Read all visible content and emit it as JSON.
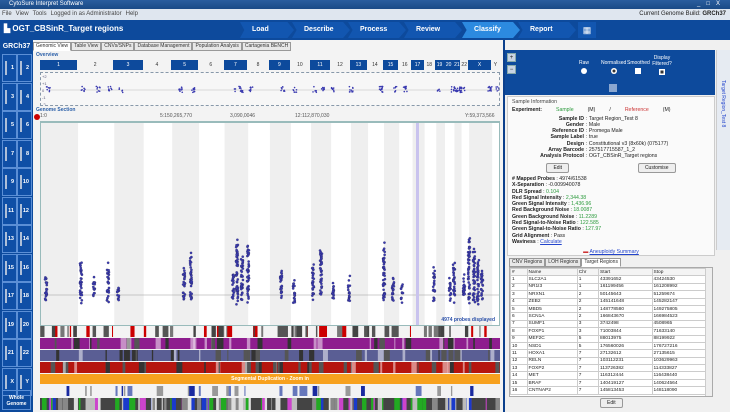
{
  "window": {
    "title": "CytoSure Interpret Software",
    "controls": [
      "_",
      "□",
      "X"
    ]
  },
  "menu": [
    "File",
    "View",
    "Tools",
    "Logged in as Administrator",
    "Help"
  ],
  "genome_build": {
    "label": "Current Genome Build:",
    "value": "GRCh37"
  },
  "document_title": "OGT_CBSinR_Target regions",
  "workflow": [
    "Load",
    "Describe",
    "Process",
    "Review",
    "Classify",
    "Report"
  ],
  "active_step": "Classify",
  "sidebar": {
    "header": "GRCh37",
    "chromosomes": [
      "1",
      "2",
      "3",
      "4",
      "5",
      "6",
      "7",
      "8",
      "9",
      "10",
      "11",
      "12",
      "13",
      "14",
      "15",
      "16",
      "17",
      "18",
      "19",
      "20",
      "21",
      "22",
      "X",
      "Y"
    ],
    "whole": "Whole Genome"
  },
  "tabs": [
    "Genomic View",
    "Table View",
    "CNVs/SNPs",
    "Database Management",
    "Population Analysis",
    "Cartagenia BENCH"
  ],
  "overview": {
    "label": "Overview",
    "chromosomes": [
      "1",
      "2",
      "3",
      "4",
      "5",
      "6",
      "7",
      "8",
      "9",
      "10",
      "11",
      "12",
      "13",
      "14",
      "15",
      "16",
      "17",
      "18",
      "19",
      "20",
      "21",
      "22",
      "X",
      "Y"
    ],
    "y_labels": [
      "+2",
      "+1",
      "0",
      "-1",
      "-2"
    ]
  },
  "genome_section": {
    "label": "Genome Section",
    "axis_labels": [
      "1:0",
      "5:150,265,770",
      "3,090,0046",
      "12:112,870,030",
      "Y:59,373,566"
    ],
    "probes_displayed": "4974 probes displayed",
    "segdup": "Segmental Duplication - Zoom in"
  },
  "display_options": [
    {
      "label": "Raw",
      "type": "radio",
      "checked": false
    },
    {
      "label": "Normalised",
      "type": "radio",
      "checked": true
    },
    {
      "label": "Smoothed",
      "type": "checkbox",
      "checked": false
    },
    {
      "label": "Display Filtered?",
      "type": "checkbox",
      "checked": true
    }
  ],
  "sample_info": {
    "title": "Sample Information",
    "experiment": {
      "label": "Experiment:",
      "sample": "Sample",
      "sample_sex": "(M)",
      "sep": "/",
      "reference": "Reference",
      "reference_sex": "(M)"
    },
    "fields": [
      {
        "k": "Sample ID",
        "v": "Target Region_Test 8"
      },
      {
        "k": "Gender",
        "v": "Male"
      },
      {
        "k": "Reference ID",
        "v": "Promega Male"
      },
      {
        "k": "Sample Label",
        "v": "true"
      },
      {
        "k": "Design",
        "v": "Constitutional v3 (8x60k) (075177)"
      },
      {
        "k": "Array Barcode",
        "v": "257517715587_1_2"
      },
      {
        "k": "Analysis Protocol",
        "v": "OGT_CBSinR_Target regions"
      }
    ],
    "edit": "Edit",
    "customise": "Customise",
    "qc": [
      {
        "k": "# Mapped Probes",
        "v": "4974/61538",
        "c": ""
      },
      {
        "k": "X-Separation",
        "v": "-0.009940078",
        "c": ""
      },
      {
        "k": "DLR Spread",
        "v": "0.104",
        "c": "g"
      },
      {
        "k": "Red Signal Intensity",
        "v": "2,344.38",
        "c": "g"
      },
      {
        "k": "Green Signal Intensity",
        "v": "1,436.96",
        "c": "g"
      },
      {
        "k": "Red Background Noise",
        "v": "18.0087",
        "c": "g"
      },
      {
        "k": "Green Background Noise",
        "v": "11.2289",
        "c": "g"
      },
      {
        "k": "Red Signal-to-Noise Ratio",
        "v": "122.585",
        "c": "g"
      },
      {
        "k": "Green Signal-to-Noise Ratio",
        "v": "127.97",
        "c": "g"
      },
      {
        "k": "Grid Alignment",
        "v": "Pass",
        "c": ""
      },
      {
        "k": "Waviness",
        "v": "Calculate",
        "c": "lk"
      }
    ],
    "summary_link": "Aneuploidy Summary"
  },
  "vertical_tab": "Target Region_Test 8",
  "region_tabs": [
    "CNV Regions",
    "LOH Regions",
    "Target Regions"
  ],
  "active_region_tab": "Target Regions",
  "table": {
    "columns": [
      "#",
      "Name",
      "Chr",
      "Start",
      "Stop"
    ],
    "rows": [
      [
        "1",
        "SLC2A1",
        "1",
        "43391652",
        "43424530"
      ],
      [
        "2",
        "NR1I3",
        "1",
        "161199456",
        "161208992"
      ],
      [
        "3",
        "NRXN1",
        "2",
        "50145643",
        "51259674"
      ],
      [
        "4",
        "ZEB2",
        "2",
        "145141648",
        "145282147"
      ],
      [
        "5",
        "MBD5",
        "2",
        "148778580",
        "149275805"
      ],
      [
        "6",
        "SCN1A",
        "2",
        "166843670",
        "166984523"
      ],
      [
        "7",
        "SUMF1",
        "3",
        "3742498",
        "4508965"
      ],
      [
        "8",
        "FOXP1",
        "3",
        "71003844",
        "71633140"
      ],
      [
        "9",
        "MEF2C",
        "5",
        "88013975",
        "88199922"
      ],
      [
        "10",
        "NSD1",
        "5",
        "176560026",
        "176727216"
      ],
      [
        "11",
        "HOXA1",
        "7",
        "27132612",
        "27135615"
      ],
      [
        "12",
        "RELN",
        "7",
        "103112231",
        "103629963"
      ],
      [
        "13",
        "FOXP2",
        "7",
        "113726382",
        "114333827"
      ],
      [
        "14",
        "MET",
        "7",
        "116312444",
        "116438440"
      ],
      [
        "15",
        "BRAF",
        "7",
        "140419127",
        "140624564"
      ],
      [
        "16",
        "CNTNAP2",
        "7",
        "145813453",
        "148118090"
      ]
    ],
    "edit": "Edit"
  },
  "colors": {
    "brand_blue": "#0d4a9c",
    "active_step": "#2c8ae0",
    "probe": "#3a3ab0",
    "segdup": "#f7a11e",
    "purple_track": "#8e1d8e",
    "slate_track": "#5a5e94",
    "red_track": "#b5150f"
  }
}
